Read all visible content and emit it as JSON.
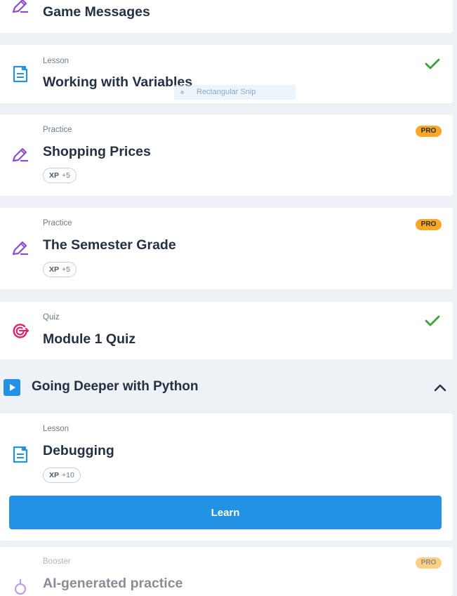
{
  "colors": {
    "accent": "#2492e4",
    "check": "#3aa33a",
    "pro_badge": "#f9a825",
    "practice_icon": "#8a4fd1",
    "quiz_icon": "#e0206a",
    "lesson_icon": "#2492e4"
  },
  "items": [
    {
      "title": "Game Messages",
      "icon": "practice-pencil-icon"
    },
    {
      "type": "Lesson",
      "title": "Working with Variables",
      "icon": "lesson-document-icon",
      "completed": true
    },
    {
      "type": "Practice",
      "title": "Shopping Prices",
      "badge": "PRO",
      "xp_label": "XP",
      "xp_value": "+5",
      "icon": "practice-pencil-icon"
    },
    {
      "type": "Practice",
      "title": "The Semester Grade",
      "badge": "PRO",
      "xp_label": "XP",
      "xp_value": "+5",
      "icon": "practice-pencil-icon"
    },
    {
      "type": "Quiz",
      "title": "Module 1 Quiz",
      "icon": "quiz-target-icon",
      "completed": true
    }
  ],
  "section": {
    "title": "Going Deeper with Python",
    "icon": "play-icon",
    "toggle_icon": "chevron-up-icon",
    "expanded": true
  },
  "current_lesson": {
    "type": "Lesson",
    "title": "Debugging",
    "xp_label": "XP",
    "xp_value": "+10",
    "button_label": "Learn",
    "icon": "lesson-document-icon"
  },
  "booster": {
    "type": "Booster",
    "title": "AI-generated practice",
    "badge": "PRO",
    "icon": "booster-flask-icon"
  },
  "overlay": {
    "snip_label": "Rectangular Snip"
  }
}
